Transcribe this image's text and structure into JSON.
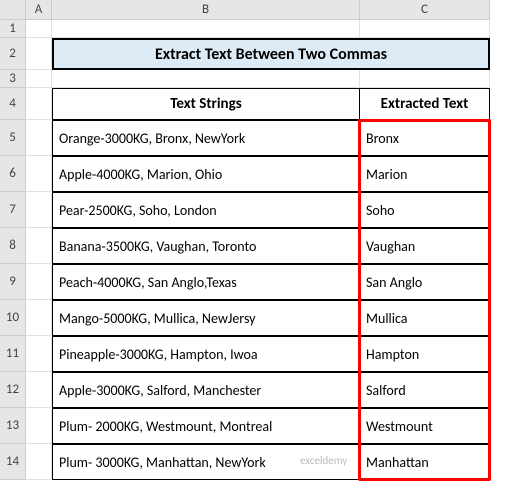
{
  "columns": [
    "A",
    "B",
    "C"
  ],
  "title": "Extract Text Between Two Commas",
  "headers": {
    "b": "Text Strings",
    "c": "Extracted Text"
  },
  "rows": [
    {
      "b": "Orange-3000KG, Bronx, NewYork",
      "c": "Bronx"
    },
    {
      "b": "Apple-4000KG, Marion, Ohio",
      "c": "Marion"
    },
    {
      "b": "Pear-2500KG, Soho, London",
      "c": "Soho"
    },
    {
      "b": "Banana-3500KG, Vaughan, Toronto",
      "c": "Vaughan"
    },
    {
      "b": "Peach-4000KG, San Anglo,Texas",
      "c": "San Anglo"
    },
    {
      "b": "Mango-5000KG, Mullica, NewJersy",
      "c": "Mullica"
    },
    {
      "b": "Pineapple-3000KG, Hampton, Iwoa",
      "c": "Hampton"
    },
    {
      "b": "Apple-3000KG, Salford, Manchester",
      "c": "Salford"
    },
    {
      "b": "Plum- 2000KG, Westmount, Montreal",
      "c": "Westmount"
    },
    {
      "b": "Plum- 3000KG, Manhattan, NewYork",
      "c": "Manhattan"
    }
  ],
  "watermark": "exceldemy"
}
